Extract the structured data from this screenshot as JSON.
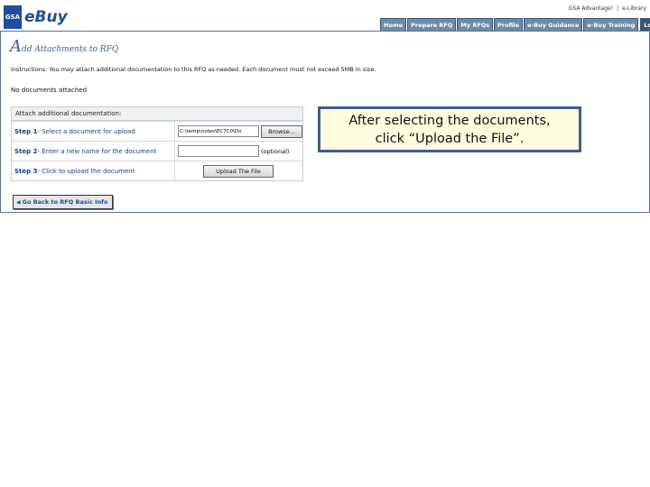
{
  "logo": {
    "gsa": "GSA",
    "ebuy": "eBuy"
  },
  "toplinks": {
    "advantage": "GSA Advantage!",
    "sep": "|",
    "library": "e-Library"
  },
  "nav": {
    "tabs": [
      "Home",
      "Prepare RFQ",
      "My RFQs",
      "Profile",
      "e-Buy Guidance",
      "e-Buy Training"
    ],
    "logoff": "Log Off"
  },
  "page": {
    "title_first": "A",
    "title_rest": "dd Attachments to RFQ",
    "instructions": "Instructions: You may attach additional documentation to this RFQ as needed. Each document must not exceed 5MB in size.",
    "no_docs": "No documents attached"
  },
  "steps": {
    "heading": "Attach additional documentation:",
    "step1_prefix": "Step 1",
    "step1_text": " - Select a document for upload",
    "file_value": "C:\\temp\\notes\\EC7C0\\Do",
    "browse_label": "Browse...",
    "step2_prefix": "Step 2",
    "step2_text": " - Enter a new name for the document",
    "optional": "(optional)",
    "step3_prefix": "Step 3",
    "step3_text": " - Click to upload the document",
    "upload_label": "Upload The File"
  },
  "back_button": {
    "arrow": "◀",
    "label": "Go Back to RFQ Basic Info"
  },
  "callout": {
    "line1": "After selecting the documents,",
    "line2": "click “Upload the File”."
  }
}
